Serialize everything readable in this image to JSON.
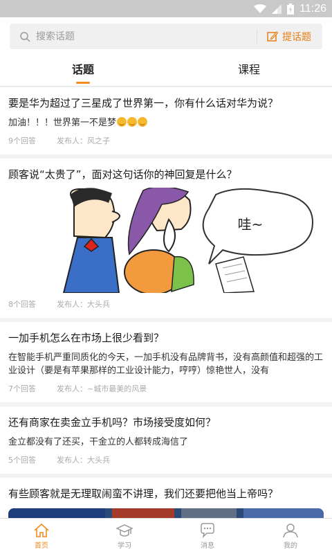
{
  "status_bar": {
    "time": "11:26"
  },
  "search": {
    "placeholder": "搜索话题",
    "ask_label": "提话题"
  },
  "tabs": [
    {
      "label": "话题",
      "active": true
    },
    {
      "label": "课程",
      "active": false
    }
  ],
  "posts": [
    {
      "question": "要是华为超过了三星成了世界第一，你有什么话对华为说？",
      "snippet": "加油！！！世界第一不是梦",
      "answers": "9个回答",
      "author": "发布人：风之子"
    },
    {
      "question": "顾客说“太贵了”，面对这句话你的神回复是什么？",
      "image_caption": "哇~",
      "answers": "8个回答",
      "author": "发布人：大头兵"
    },
    {
      "question": "一加手机怎么在市场上很少看到？",
      "snippet": "在智能手机严重同质化的今天，一加手机没有品牌背书，没有高颜值和超强的工业设计（要是有苹果那样的工业设计能力，哼哼）惊艳世人，没有",
      "answers": "7个回答",
      "author": "发布人：~城市最美的风景"
    },
    {
      "question": "还有商家在卖金立手机吗？市场接受度如何？",
      "snippet": "金立都没有了还买，干金立的人都转成海信了",
      "answers": "5个回答",
      "author": "发布人：大头兵"
    },
    {
      "question": "有些顾客就是无理取闹蛮不讲理，我们还要把他当上帝吗？"
    }
  ],
  "bottom_nav": [
    {
      "label": "首页",
      "icon": "home-icon",
      "active": true
    },
    {
      "label": "学习",
      "icon": "graduation-cap-icon",
      "active": false
    },
    {
      "label": "消息",
      "icon": "chat-bubble-icon",
      "active": false
    },
    {
      "label": "我的",
      "icon": "user-icon",
      "active": false
    }
  ],
  "colors": {
    "accent": "#f08a1c",
    "status_bar": "#c9c9c9"
  }
}
